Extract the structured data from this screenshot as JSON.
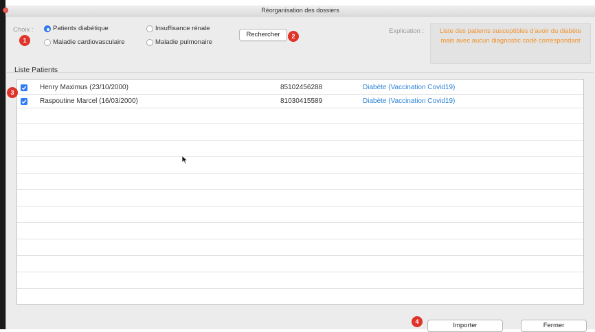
{
  "window": {
    "title": "Réorganisation des dossiers"
  },
  "choice": {
    "label": "Choix :",
    "options": [
      {
        "label": "Patients diabétique",
        "selected": true
      },
      {
        "label": "Insuffisance rénale",
        "selected": false
      },
      {
        "label": "Maladie cardiovasculaire",
        "selected": false
      },
      {
        "label": "Maladie pulmonaire",
        "selected": false
      }
    ]
  },
  "search_button": "Rechercher",
  "explanation": {
    "label": "Explication :",
    "text": "Liste des patients susceptibles d'avoir du diabète mais avec aucun diagnostic codé correspondant"
  },
  "list": {
    "title": "Liste Patients",
    "rows": [
      {
        "checked": true,
        "name": "Henry Maximus (23/10/2000)",
        "number": "85102456288",
        "reason": "Diabète (Vaccination Covid19)"
      },
      {
        "checked": true,
        "name": "Raspoutine Marcel (16/03/2000)",
        "number": "81030415589",
        "reason": "Diabète (Vaccination Covid19)"
      }
    ]
  },
  "buttons": {
    "import": "Importer",
    "close": "Fermer"
  },
  "badges": [
    "1",
    "2",
    "3",
    "4"
  ],
  "colors": {
    "accent": "#2f7bf5",
    "badge": "#e0332a",
    "explanation_text": "#f0922c",
    "link": "#2b82d9"
  }
}
